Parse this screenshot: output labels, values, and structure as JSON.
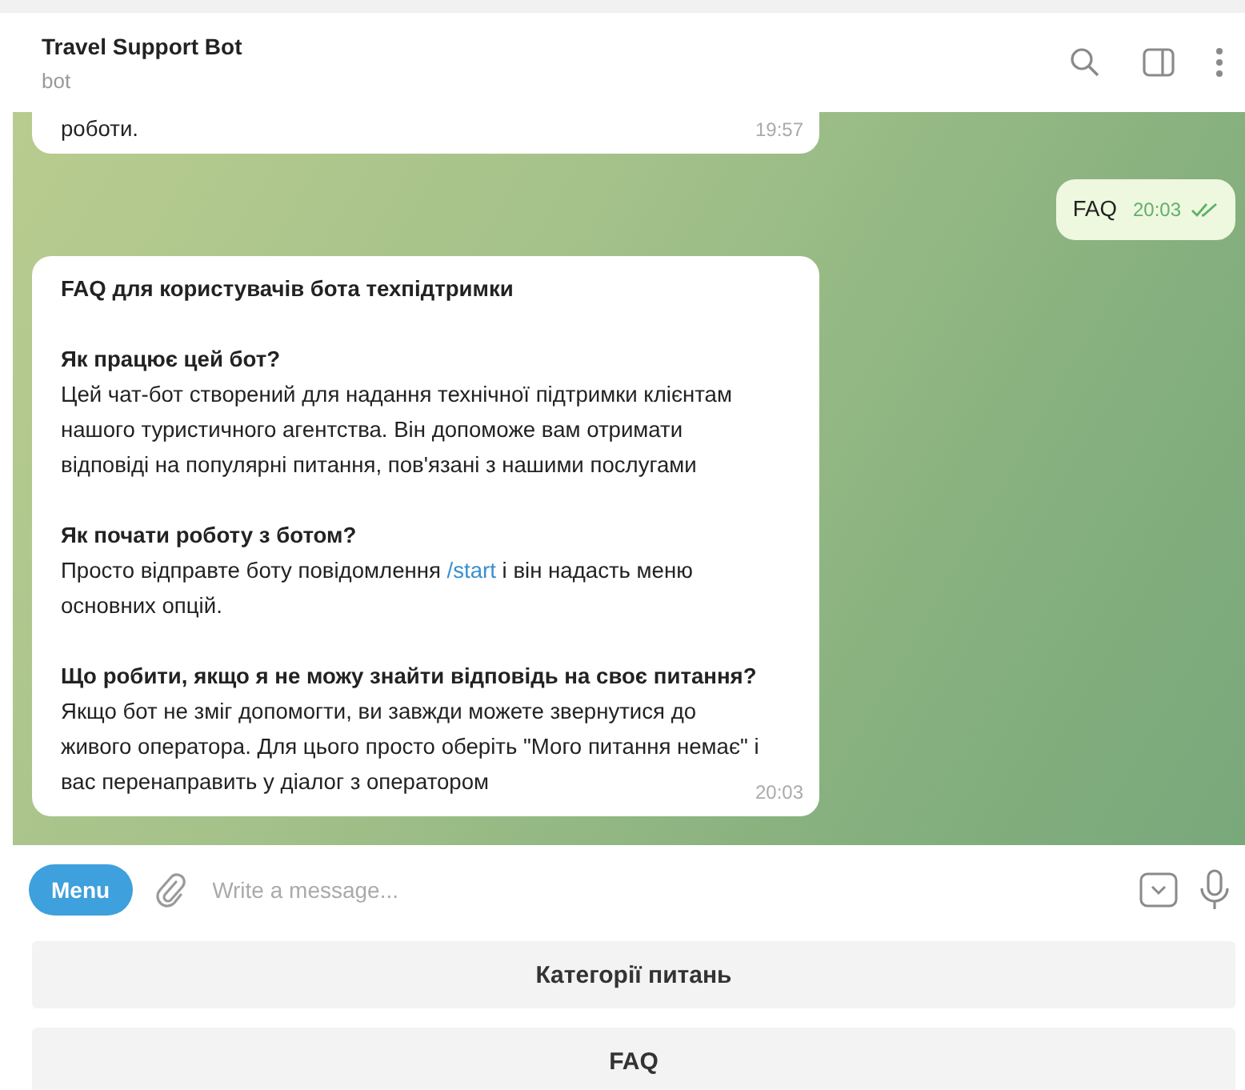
{
  "header": {
    "title": "Travel Support Bot",
    "subtitle": "bot"
  },
  "messages": [
    {
      "kind": "incoming",
      "partial": true,
      "blocks": [
        {
          "kind": "answer",
          "parts": [
            {
              "kind": "text",
              "text": "роботи."
            }
          ]
        }
      ],
      "time": "19:57"
    },
    {
      "kind": "outgoing",
      "partial": false,
      "blocks": [
        {
          "kind": "answer",
          "parts": [
            {
              "kind": "text",
              "text": "FAQ"
            }
          ]
        }
      ],
      "time": "20:03",
      "read": true
    },
    {
      "kind": "incoming",
      "partial": false,
      "blocks": [
        {
          "kind": "question",
          "text": "FAQ для користувачів бота техпідтримки"
        },
        {
          "kind": "question",
          "text": "Як працює цей бот?"
        },
        {
          "kind": "answer",
          "parts": [
            {
              "kind": "text",
              "text": "Цей чат-бот створений для надання технічної підтримки клієнтам нашого туристичного агентства. Він допоможе вам отримати відповіді на популярні питання, пов'язані з нашими послугами"
            }
          ]
        },
        {
          "kind": "question",
          "text": "Як почати роботу з ботом?"
        },
        {
          "kind": "answer",
          "parts": [
            {
              "kind": "text",
              "text": "Просто відправте боту повідомлення "
            },
            {
              "kind": "command",
              "text": "/start"
            },
            {
              "kind": "text",
              "text": " і він надасть меню основних опцій."
            }
          ]
        },
        {
          "kind": "question",
          "text": "Що робити, якщо я не можу знайти відповідь на своє питання?"
        },
        {
          "kind": "answer",
          "parts": [
            {
              "kind": "text",
              "text": "Якщо бот не зміг допомогти, ви завжди можете звернутися до живого оператора. Для цього просто оберіть \"Мого питання немає\" і вас перенаправить у діалог з оператором"
            }
          ]
        }
      ],
      "time": "20:03"
    }
  ],
  "composer": {
    "menu_label": "Menu",
    "placeholder": "Write a message..."
  },
  "keyboard": [
    "Категорії питань",
    "FAQ"
  ]
}
